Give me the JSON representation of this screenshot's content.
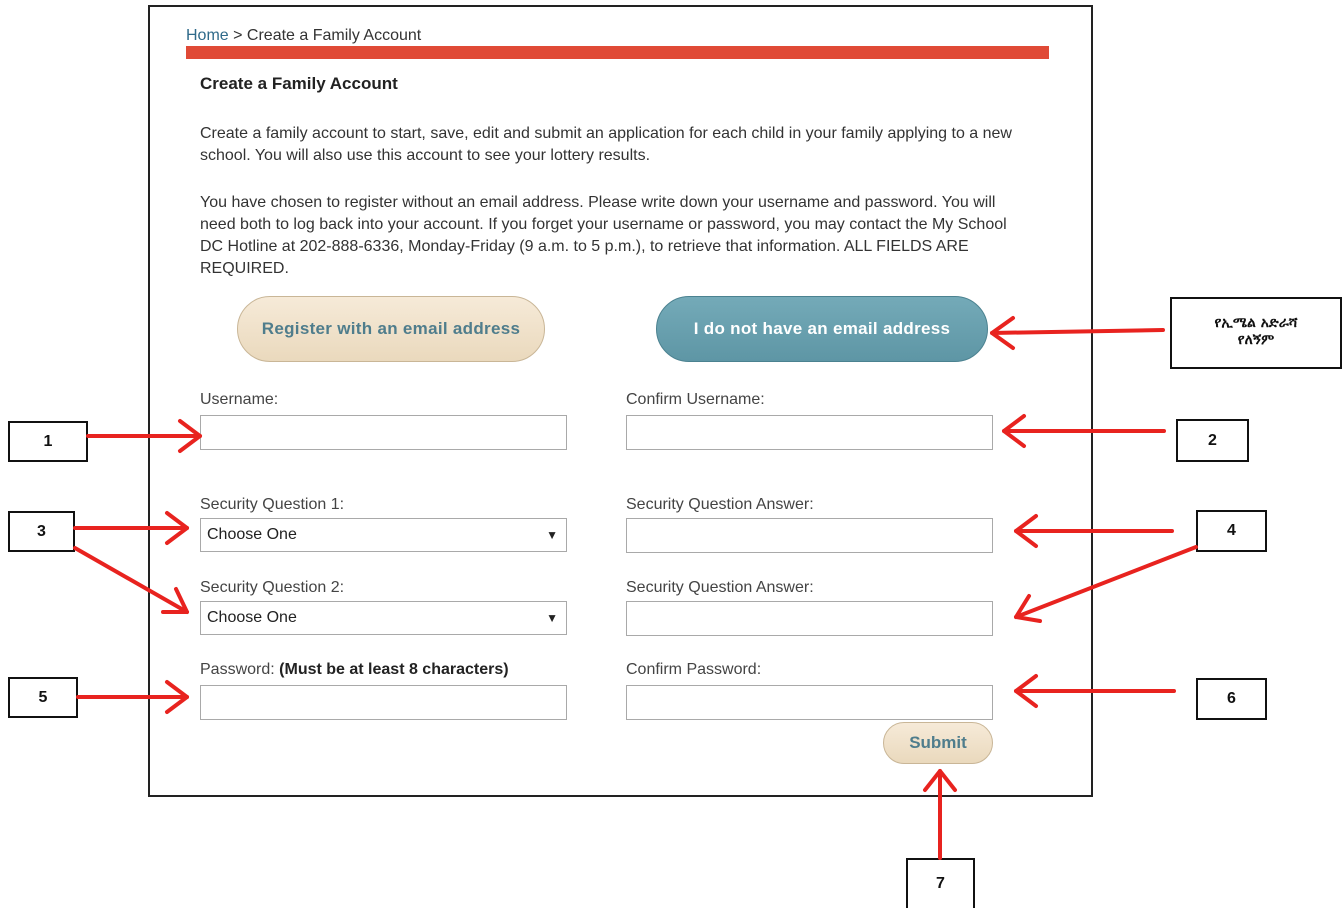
{
  "breadcrumb": {
    "home": "Home",
    "separator": " > ",
    "current": "Create a Family Account"
  },
  "page": {
    "title": "Create a Family Account",
    "intro": "Create a family account to start, save, edit and submit an application for each child in your family applying to a new school. You will also use this account to see your lottery results.",
    "notice": "You have chosen to register without an email address. Please write down your username and password. You will need both to log back into your account. If you forget your username or password, you may contact the My School DC Hotline at 202-888-6336, Monday-Friday (9 a.m. to 5 p.m.), to retrieve that information. ALL FIELDS ARE REQUIRED."
  },
  "buttons": {
    "register_email": "Register with an email address",
    "no_email": "I do not have an email address",
    "submit": "Submit"
  },
  "form": {
    "username_label": "Username:",
    "confirm_username_label": "Confirm Username:",
    "security_q1_label": "Security Question 1:",
    "security_q2_label": "Security Question 2:",
    "security_answer_label": "Security Question Answer:",
    "select_placeholder": "Choose One",
    "password_label": "Password:",
    "password_hint": "(Must be at least 8 characters)",
    "confirm_password_label": "Confirm Password:"
  },
  "annotations": {
    "amharic_line1": "የኢሜል አድራሻ",
    "amharic_line2": "የለኝም",
    "callouts": [
      "1",
      "2",
      "3",
      "4",
      "5",
      "6",
      "7"
    ],
    "arrow_color": "#e8231f"
  }
}
